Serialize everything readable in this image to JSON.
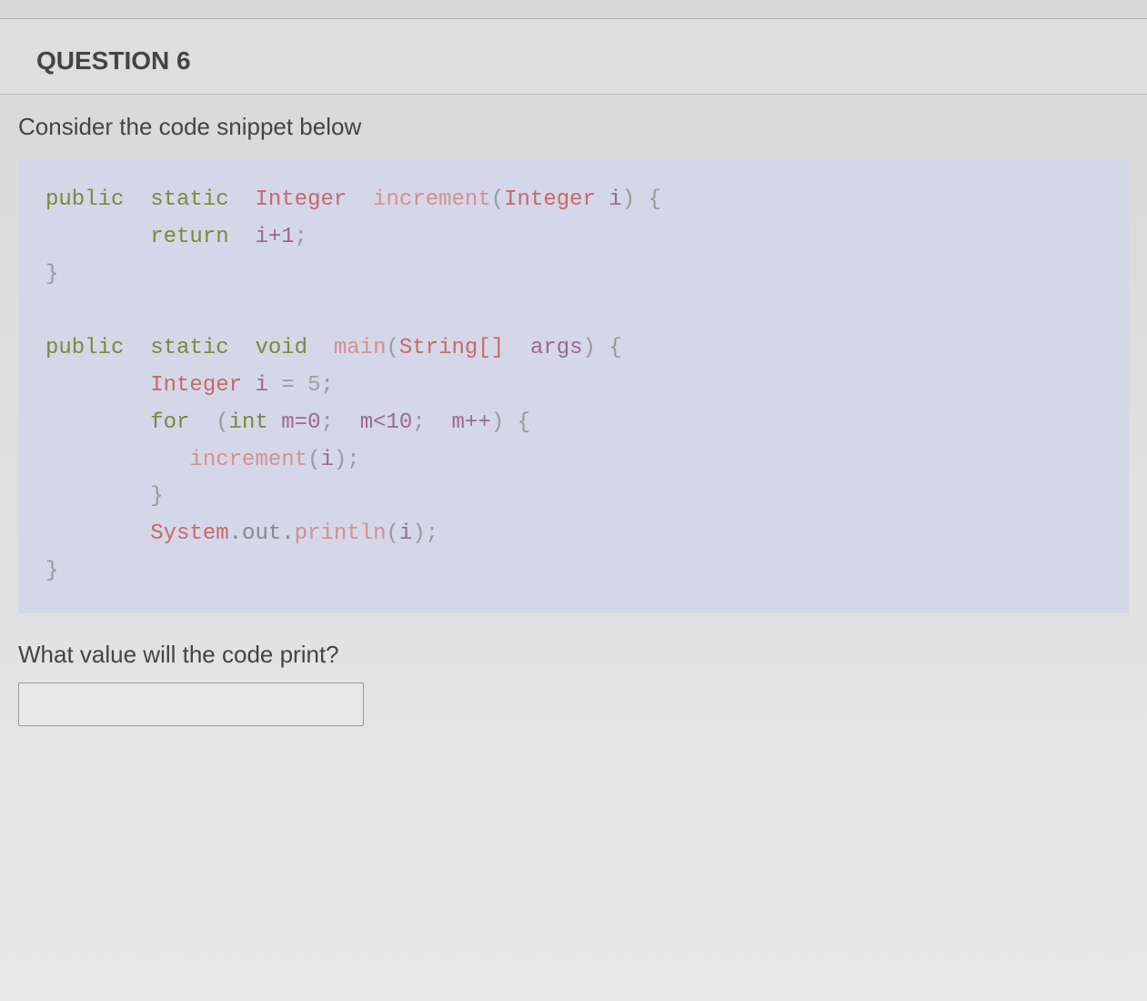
{
  "question": {
    "title": "QUESTION 6",
    "intro": "Consider the code snippet below",
    "prompt": "What value will the code print?"
  },
  "code": {
    "line1_public": "public",
    "line1_static": "static",
    "line1_type": "Integer",
    "line1_method": "increment",
    "line1_paramtype": "Integer",
    "line1_param": "i",
    "line1_brace": ") {",
    "line2_return": "return",
    "line2_expr": "i+1",
    "line2_semi": ";",
    "line3_brace": "}",
    "line5_public": "public",
    "line5_static": "static",
    "line5_void": "void",
    "line5_method": "main",
    "line5_paramtype": "String[]",
    "line5_param": "args",
    "line5_brace": ") {",
    "line6_type": "Integer",
    "line6_var": "i",
    "line6_eq": " = ",
    "line6_val": "5",
    "line6_semi": ";",
    "line7_for": "for",
    "line7_int": "int",
    "line7_m0": "m=0",
    "line7_cond": "m<10",
    "line7_inc": "m++",
    "line7_brace": ") {",
    "line8_method": "increment",
    "line8_arg": "i",
    "line8_end": ");",
    "line9_brace": "}",
    "line10_class": "System",
    "line10_field": ".out.",
    "line10_method": "println",
    "line10_arg": "i",
    "line10_end": ");",
    "line11_brace": "}"
  },
  "answer": {
    "value": ""
  }
}
